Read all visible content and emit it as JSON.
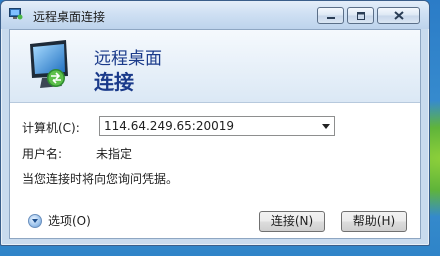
{
  "window": {
    "title": "远程桌面连接"
  },
  "banner": {
    "line1": "远程桌面",
    "line2": "连接"
  },
  "form": {
    "computer_label": "计算机(C):",
    "computer_value": "114.64.249.65:20019",
    "username_label": "用户名:",
    "username_value": "未指定",
    "info_text": "当您连接时将向您询问凭据。"
  },
  "footer": {
    "options_label": "选项(O)",
    "connect_label": "连接(N)",
    "help_label": "帮助(H)"
  }
}
